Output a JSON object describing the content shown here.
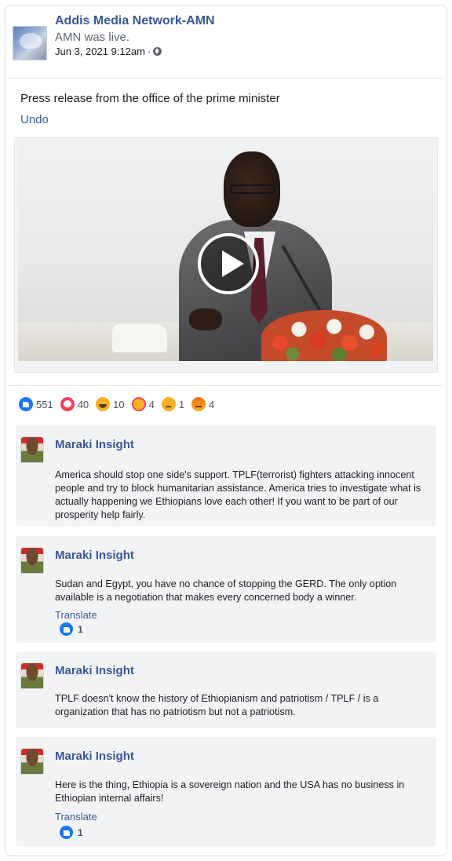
{
  "post": {
    "page_name": "Addis Media Network-AMN",
    "status": "AMN was live.",
    "timestamp": "Jun 3, 2021 9:12am",
    "separator": "·",
    "text": "Press release from the office of the prime minister",
    "undo_label": "Undo"
  },
  "reactions": [
    {
      "type": "like",
      "icon": "like-icon",
      "count": "551"
    },
    {
      "type": "love",
      "icon": "love-icon",
      "count": "40"
    },
    {
      "type": "haha",
      "icon": "haha-icon",
      "count": "10"
    },
    {
      "type": "care",
      "icon": "care-icon",
      "count": "4"
    },
    {
      "type": "sad",
      "icon": "sad-icon",
      "count": "1"
    },
    {
      "type": "angry",
      "icon": "angry-icon",
      "count": "4"
    }
  ],
  "comments": [
    {
      "author": "Maraki Insight",
      "text": "America should stop one side's support. TPLF(terrorist) fighters attacking innocent people and try to block humanitarian assistance. America tries to investigate what is actually happening we Ethiopians love each other! If you want to be part of our prosperity help fairly."
    },
    {
      "author": "Maraki Insight",
      "text": "Sudan and Egypt, you have no chance of stopping the GERD. The only option available is a negotiation that makes every concerned body a winner.",
      "translate_label": "Translate",
      "like_count": "1"
    },
    {
      "author": "Maraki Insight",
      "text": "TPLF doesn't know the history of Ethiopianism and patriotism / TPLF / is a organization that has no patriotism but not a patriotism."
    },
    {
      "author": "Maraki Insight",
      "text": "Here is the thing, Ethiopia is a sovereign nation and the USA has no business in Ethiopian internal affairs!",
      "translate_label": "Translate",
      "like_count": "1"
    }
  ],
  "colors": {
    "link_blue": "#385898",
    "like_blue": "#1877f2",
    "love_red": "#f33e58",
    "reaction_yellow": "#f7b125",
    "comment_bg": "#f2f3f5"
  }
}
